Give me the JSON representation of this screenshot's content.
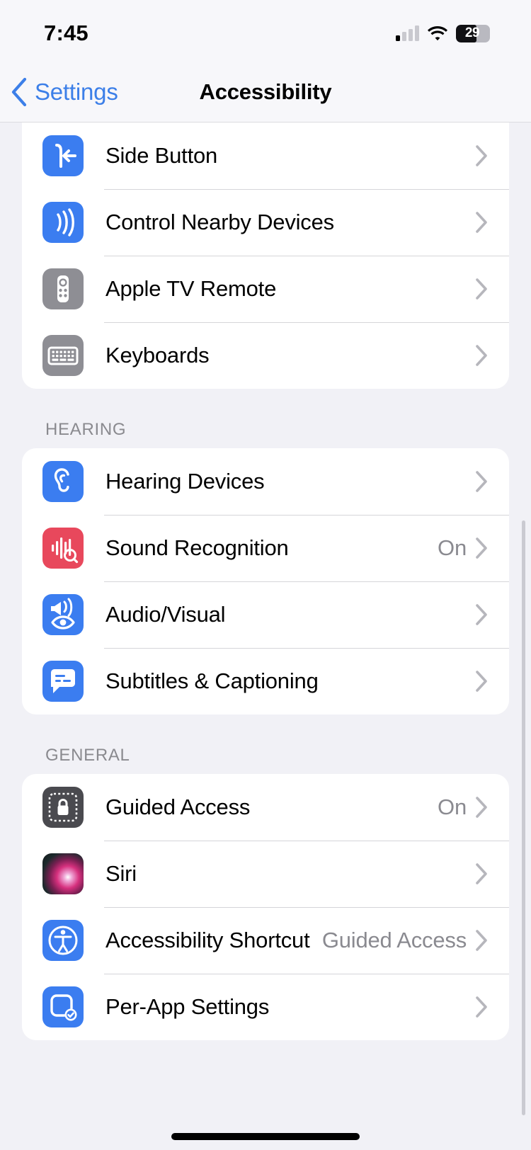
{
  "status_bar": {
    "time": "7:45",
    "signal_icon": "cellular-signal-icon",
    "signal_bars_active": 1,
    "wifi_icon": "wifi-icon",
    "battery_icon": "battery-icon",
    "battery_percent": "29"
  },
  "nav": {
    "back_label": "Settings",
    "back_icon": "chevron-left-icon",
    "title": "Accessibility"
  },
  "colors": {
    "accent_blue": "#3c7fe8",
    "icon_blue": "#3b7df0",
    "icon_gray": "#8e8e94",
    "icon_red": "#e8485c",
    "icon_dark": "#4a4a4f",
    "page_background": "#f1f1f6",
    "card_background": "#ffffff",
    "secondary_text": "#8a8a90",
    "separator": "#d5d5d9"
  },
  "sections": [
    {
      "header": "",
      "rows": [
        {
          "label": "Side Button",
          "value": "",
          "icon": "side-button-icon",
          "chevron": "chevron-right-icon"
        },
        {
          "label": "Control Nearby Devices",
          "value": "",
          "icon": "nearby-devices-waves-icon",
          "chevron": "chevron-right-icon"
        },
        {
          "label": "Apple TV Remote",
          "value": "",
          "icon": "apple-tv-remote-icon",
          "chevron": "chevron-right-icon"
        },
        {
          "label": "Keyboards",
          "value": "",
          "icon": "keyboard-icon",
          "chevron": "chevron-right-icon"
        }
      ]
    },
    {
      "header": "HEARING",
      "rows": [
        {
          "label": "Hearing Devices",
          "value": "",
          "icon": "ear-icon",
          "chevron": "chevron-right-icon"
        },
        {
          "label": "Sound Recognition",
          "value": "On",
          "icon": "sound-recognition-icon",
          "chevron": "chevron-right-icon"
        },
        {
          "label": "Audio/Visual",
          "value": "",
          "icon": "audio-visual-icon",
          "chevron": "chevron-right-icon"
        },
        {
          "label": "Subtitles & Captioning",
          "value": "",
          "icon": "captioning-bubble-icon",
          "chevron": "chevron-right-icon"
        }
      ]
    },
    {
      "header": "GENERAL",
      "rows": [
        {
          "label": "Guided Access",
          "value": "On",
          "icon": "guided-access-lock-icon",
          "chevron": "chevron-right-icon"
        },
        {
          "label": "Siri",
          "value": "",
          "icon": "siri-orb-icon",
          "chevron": "chevron-right-icon"
        },
        {
          "label": "Accessibility Shortcut",
          "value": "Guided Access",
          "icon": "accessibility-person-icon",
          "chevron": "chevron-right-icon"
        },
        {
          "label": "Per-App Settings",
          "value": "",
          "icon": "per-app-settings-icon",
          "chevron": "chevron-right-icon"
        }
      ]
    }
  ]
}
